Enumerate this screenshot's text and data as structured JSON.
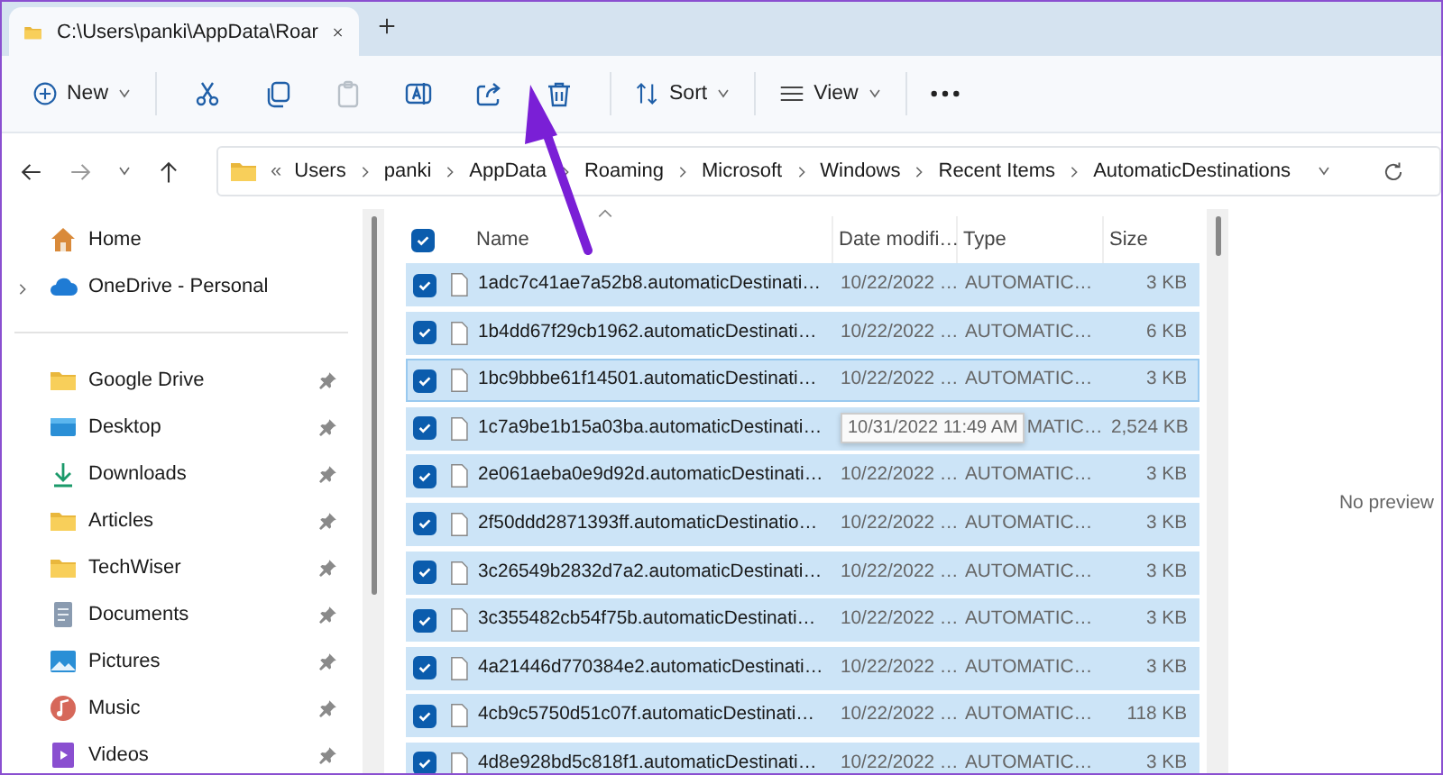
{
  "tab": {
    "title": "C:\\Users\\panki\\AppData\\Roar"
  },
  "toolbar": {
    "new_label": "New",
    "sort_label": "Sort",
    "view_label": "View",
    "actions": [
      {
        "kind": "cut",
        "disabled": false
      },
      {
        "kind": "copy",
        "disabled": false
      },
      {
        "kind": "paste",
        "disabled": true
      },
      {
        "kind": "rename",
        "disabled": false
      },
      {
        "kind": "share",
        "disabled": false
      },
      {
        "kind": "delete",
        "disabled": false
      }
    ]
  },
  "address": {
    "overflow": "«",
    "crumbs": [
      "Users",
      "panki",
      "AppData",
      "Roaming",
      "Microsoft",
      "Windows",
      "Recent Items",
      "AutomaticDestinations"
    ]
  },
  "sidebar": {
    "top": [
      {
        "label": "Home",
        "kind": "home",
        "expandable": false
      },
      {
        "label": "OneDrive - Personal",
        "kind": "cloud",
        "expandable": true
      }
    ],
    "quick_access": [
      {
        "label": "Google Drive",
        "kind": "folder",
        "pinned": true
      },
      {
        "label": "Desktop",
        "kind": "desktop",
        "pinned": true
      },
      {
        "label": "Downloads",
        "kind": "download",
        "pinned": true
      },
      {
        "label": "Articles",
        "kind": "folder",
        "pinned": true
      },
      {
        "label": "TechWiser",
        "kind": "folder",
        "pinned": true
      },
      {
        "label": "Documents",
        "kind": "document",
        "pinned": true
      },
      {
        "label": "Pictures",
        "kind": "picture",
        "pinned": true
      },
      {
        "label": "Music",
        "kind": "music",
        "pinned": true
      },
      {
        "label": "Videos",
        "kind": "video",
        "pinned": true
      }
    ]
  },
  "table": {
    "all_checked": true,
    "columns": [
      "Name",
      "Date modifi…",
      "Type",
      "Size"
    ],
    "rows": [
      {
        "name": "1adc7c41ae7a52b8.automaticDestinati…",
        "date": "10/22/2022 …",
        "type": "AUTOMATIC…",
        "size": "3 KB",
        "selected": true,
        "focused": false,
        "hovered": false
      },
      {
        "name": "1b4dd67f29cb1962.automaticDestinati…",
        "date": "10/22/2022 …",
        "type": "AUTOMATIC…",
        "size": "6 KB",
        "selected": true,
        "focused": false,
        "hovered": false
      },
      {
        "name": "1bc9bbbe61f14501.automaticDestinati…",
        "date": "10/22/2022 …",
        "type": "AUTOMATIC…",
        "size": "3 KB",
        "selected": true,
        "focused": true,
        "hovered": false
      },
      {
        "name": "1c7a9be1b15a03ba.automaticDestinati…",
        "date": "10/31/2022 11:49 AM",
        "type": "MATIC…",
        "size": "2,524 KB",
        "selected": true,
        "focused": false,
        "hovered": true
      },
      {
        "name": "2e061aeba0e9d92d.automaticDestinati…",
        "date": "10/22/2022 …",
        "type": "AUTOMATIC…",
        "size": "3 KB",
        "selected": true,
        "focused": false,
        "hovered": false
      },
      {
        "name": "2f50ddd2871393ff.automaticDestinatio…",
        "date": "10/22/2022 …",
        "type": "AUTOMATIC…",
        "size": "3 KB",
        "selected": true,
        "focused": false,
        "hovered": false
      },
      {
        "name": "3c26549b2832d7a2.automaticDestinati…",
        "date": "10/22/2022 …",
        "type": "AUTOMATIC…",
        "size": "3 KB",
        "selected": true,
        "focused": false,
        "hovered": false
      },
      {
        "name": "3c355482cb54f75b.automaticDestinati…",
        "date": "10/22/2022 …",
        "type": "AUTOMATIC…",
        "size": "3 KB",
        "selected": true,
        "focused": false,
        "hovered": false
      },
      {
        "name": "4a21446d770384e2.automaticDestinati…",
        "date": "10/22/2022 …",
        "type": "AUTOMATIC…",
        "size": "3 KB",
        "selected": true,
        "focused": false,
        "hovered": false
      },
      {
        "name": "4cb9c5750d51c07f.automaticDestinati…",
        "date": "10/22/2022 …",
        "type": "AUTOMATIC…",
        "size": "118 KB",
        "selected": true,
        "focused": false,
        "hovered": false
      },
      {
        "name": "4d8e928bd5c818f1.automaticDestinati…",
        "date": "10/22/2022 …",
        "type": "AUTOMATIC…",
        "size": "3 KB",
        "selected": true,
        "focused": false,
        "hovered": false
      }
    ]
  },
  "preview": {
    "message": "No preview"
  }
}
